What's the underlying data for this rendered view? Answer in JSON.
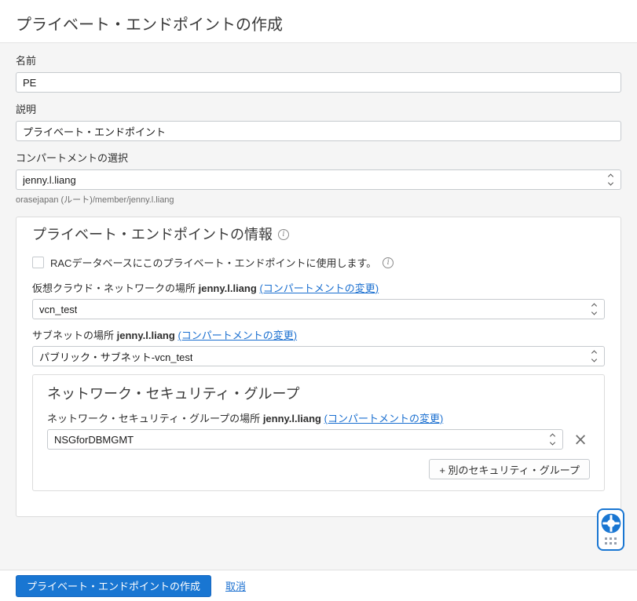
{
  "page": {
    "title": "プライベート・エンドポイントの作成"
  },
  "fields": {
    "name": {
      "label": "名前",
      "value": "PE"
    },
    "description": {
      "label": "説明",
      "value": "プライベート・エンドポイント"
    },
    "compartment": {
      "label": "コンパートメントの選択",
      "value": "jenny.l.liang",
      "helper": "orasejapan (ルート)/member/jenny.l.liang"
    }
  },
  "info_section": {
    "title": "プライベート・エンドポイントの情報",
    "rac_checkbox_label": "RACデータベースにこのプライベート・エンドポイントに使用します。",
    "vcn": {
      "label_prefix": "仮想クラウド・ネットワークの場所",
      "compartment": "jenny.l.liang",
      "change_link": "(コンパートメントの変更)",
      "value": "vcn_test"
    },
    "subnet": {
      "label_prefix": "サブネットの場所",
      "compartment": "jenny.l.liang",
      "change_link": "(コンパートメントの変更)",
      "value": "パブリック・サブネット-vcn_test"
    },
    "nsg_section": {
      "title": "ネットワーク・セキュリティ・グループ",
      "label_prefix": "ネットワーク・セキュリティ・グループの場所",
      "compartment": "jenny.l.liang",
      "change_link": "(コンパートメントの変更)",
      "value": "NSGforDBMGMT",
      "add_button_label": "+ 別のセキュリティ・グループ"
    }
  },
  "footer": {
    "create_button_label": "プライベート・エンドポイントの作成",
    "cancel_label": "取消"
  },
  "colors": {
    "primary_button": "#1976d2",
    "link": "#1a6fd0",
    "page_background": "#f5f5f5"
  }
}
